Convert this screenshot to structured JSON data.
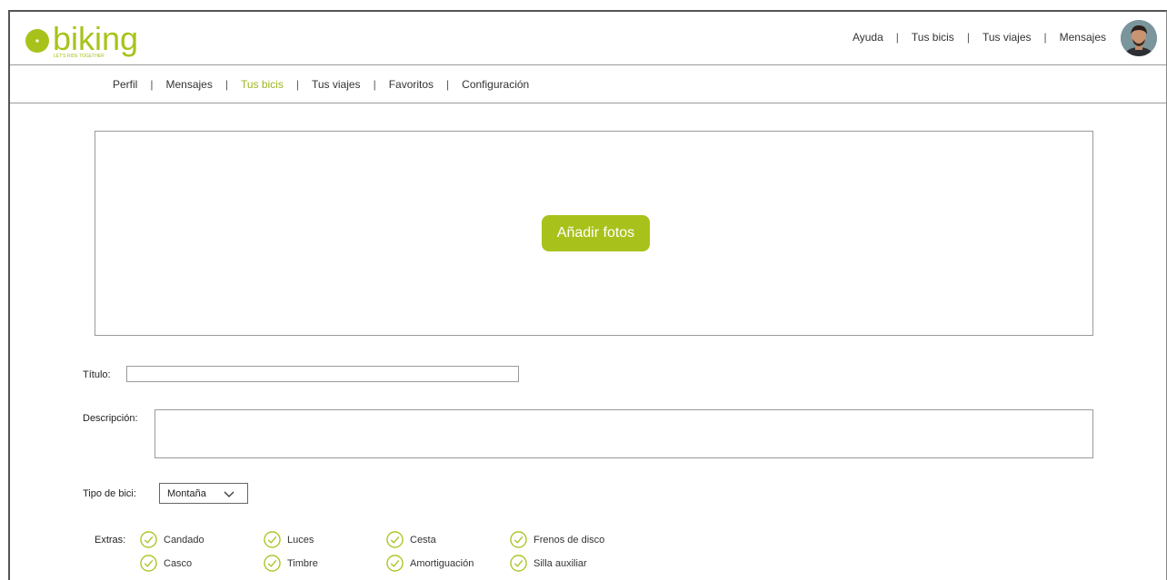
{
  "brand": {
    "name": "biking",
    "tagline": "LET'S RIDE TOGETHER",
    "color": "#a9c21b"
  },
  "top_nav": {
    "items": [
      "Ayuda",
      "Tus bicis",
      "Tus viajes",
      "Mensajes"
    ],
    "separator": "|"
  },
  "sub_nav": {
    "items": [
      "Perfil",
      "Mensajes",
      "Tus bicis",
      "Tus viajes",
      "Favoritos",
      "Configuración"
    ],
    "active": "Tus bicis",
    "separator": "|"
  },
  "photos": {
    "button_label": "Añadir fotos"
  },
  "form": {
    "title_label": "Título:",
    "title_value": "",
    "description_label": "Descripción:",
    "description_value": "",
    "bike_type_label": "Tipo de bici:",
    "bike_type_value": "Montaña",
    "extras_label": "Extras:",
    "extras": [
      "Candado",
      "Luces",
      "Cesta",
      "Frenos de disco",
      "Casco",
      "Timbre",
      "Amortiguación",
      "Silla auxiliar"
    ]
  }
}
